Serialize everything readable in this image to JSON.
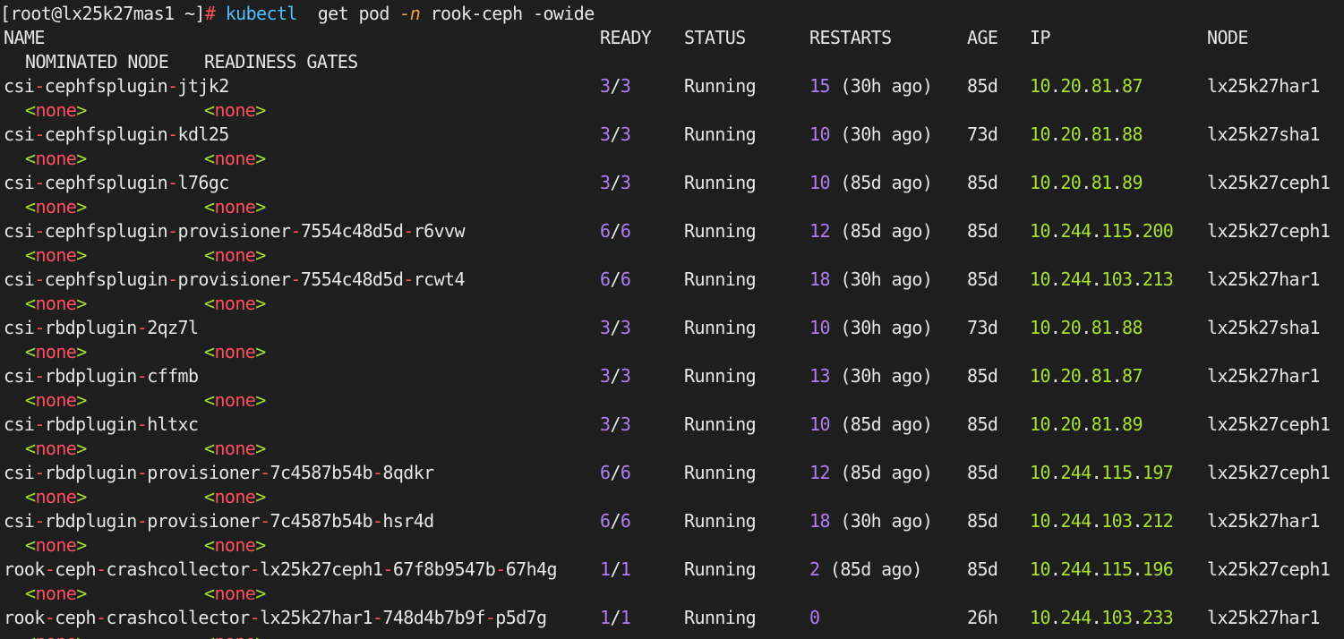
{
  "prompt": {
    "ps1": "[root@lx25k27mas1 ~]",
    "hash": "#",
    "command": "kubectl",
    "arg_get": "get pod",
    "flag_n": "-n",
    "namespace": "rook-ceph",
    "flag_owide": "-owide"
  },
  "headers": {
    "name": "NAME",
    "ready": "READY",
    "status": "STATUS",
    "restarts": "RESTARTS",
    "age": "AGE",
    "ip": "IP",
    "node": "NODE",
    "nominated": "NOMINATED NODE",
    "gates": "READINESS GATES"
  },
  "none_label": "none",
  "rows": [
    {
      "name": "csi-cephfsplugin-jtjk2",
      "ready": "3/3",
      "status": "Running",
      "restart_count": "15",
      "restart_ago": "(30h ago)",
      "age": "85d",
      "ip": "10.20.81.87",
      "node": "lx25k27har1"
    },
    {
      "name": "csi-cephfsplugin-kdl25",
      "ready": "3/3",
      "status": "Running",
      "restart_count": "10",
      "restart_ago": "(30h ago)",
      "age": "73d",
      "ip": "10.20.81.88",
      "node": "lx25k27sha1"
    },
    {
      "name": "csi-cephfsplugin-l76gc",
      "ready": "3/3",
      "status": "Running",
      "restart_count": "10",
      "restart_ago": "(85d ago)",
      "age": "85d",
      "ip": "10.20.81.89",
      "node": "lx25k27ceph1"
    },
    {
      "name": "csi-cephfsplugin-provisioner-7554c48d5d-r6vvw",
      "ready": "6/6",
      "status": "Running",
      "restart_count": "12",
      "restart_ago": "(85d ago)",
      "age": "85d",
      "ip": "10.244.115.200",
      "node": "lx25k27ceph1"
    },
    {
      "name": "csi-cephfsplugin-provisioner-7554c48d5d-rcwt4",
      "ready": "6/6",
      "status": "Running",
      "restart_count": "18",
      "restart_ago": "(30h ago)",
      "age": "85d",
      "ip": "10.244.103.213",
      "node": "lx25k27har1"
    },
    {
      "name": "csi-rbdplugin-2qz7l",
      "ready": "3/3",
      "status": "Running",
      "restart_count": "10",
      "restart_ago": "(30h ago)",
      "age": "73d",
      "ip": "10.20.81.88",
      "node": "lx25k27sha1"
    },
    {
      "name": "csi-rbdplugin-cffmb",
      "ready": "3/3",
      "status": "Running",
      "restart_count": "13",
      "restart_ago": "(30h ago)",
      "age": "85d",
      "ip": "10.20.81.87",
      "node": "lx25k27har1"
    },
    {
      "name": "csi-rbdplugin-hltxc",
      "ready": "3/3",
      "status": "Running",
      "restart_count": "10",
      "restart_ago": "(85d ago)",
      "age": "85d",
      "ip": "10.20.81.89",
      "node": "lx25k27ceph1"
    },
    {
      "name": "csi-rbdplugin-provisioner-7c4587b54b-8qdkr",
      "ready": "6/6",
      "status": "Running",
      "restart_count": "12",
      "restart_ago": "(85d ago)",
      "age": "85d",
      "ip": "10.244.115.197",
      "node": "lx25k27ceph1"
    },
    {
      "name": "csi-rbdplugin-provisioner-7c4587b54b-hsr4d",
      "ready": "6/6",
      "status": "Running",
      "restart_count": "18",
      "restart_ago": "(30h ago)",
      "age": "85d",
      "ip": "10.244.103.212",
      "node": "lx25k27har1"
    },
    {
      "name": "rook-ceph-crashcollector-lx25k27ceph1-67f8b9547b-67h4g",
      "ready": "1/1",
      "status": "Running",
      "restart_count": "2",
      "restart_ago": "(85d ago)",
      "age": "85d",
      "ip": "10.244.115.196",
      "node": "lx25k27ceph1"
    },
    {
      "name": "rook-ceph-crashcollector-lx25k27har1-748d4b7b9f-p5d7g",
      "ready": "1/1",
      "status": "Running",
      "restart_count": "0",
      "restart_ago": "",
      "age": "26h",
      "ip": "10.244.103.233",
      "node": "lx25k27har1"
    }
  ],
  "colors": {
    "background": "#1e1e1e",
    "foreground": "#e6e6e6",
    "red": "#ff4f5e",
    "purple": "#b07cf2",
    "green": "#a6e22e",
    "cyan": "#4fc1ff",
    "orange": "#f0a03c"
  }
}
